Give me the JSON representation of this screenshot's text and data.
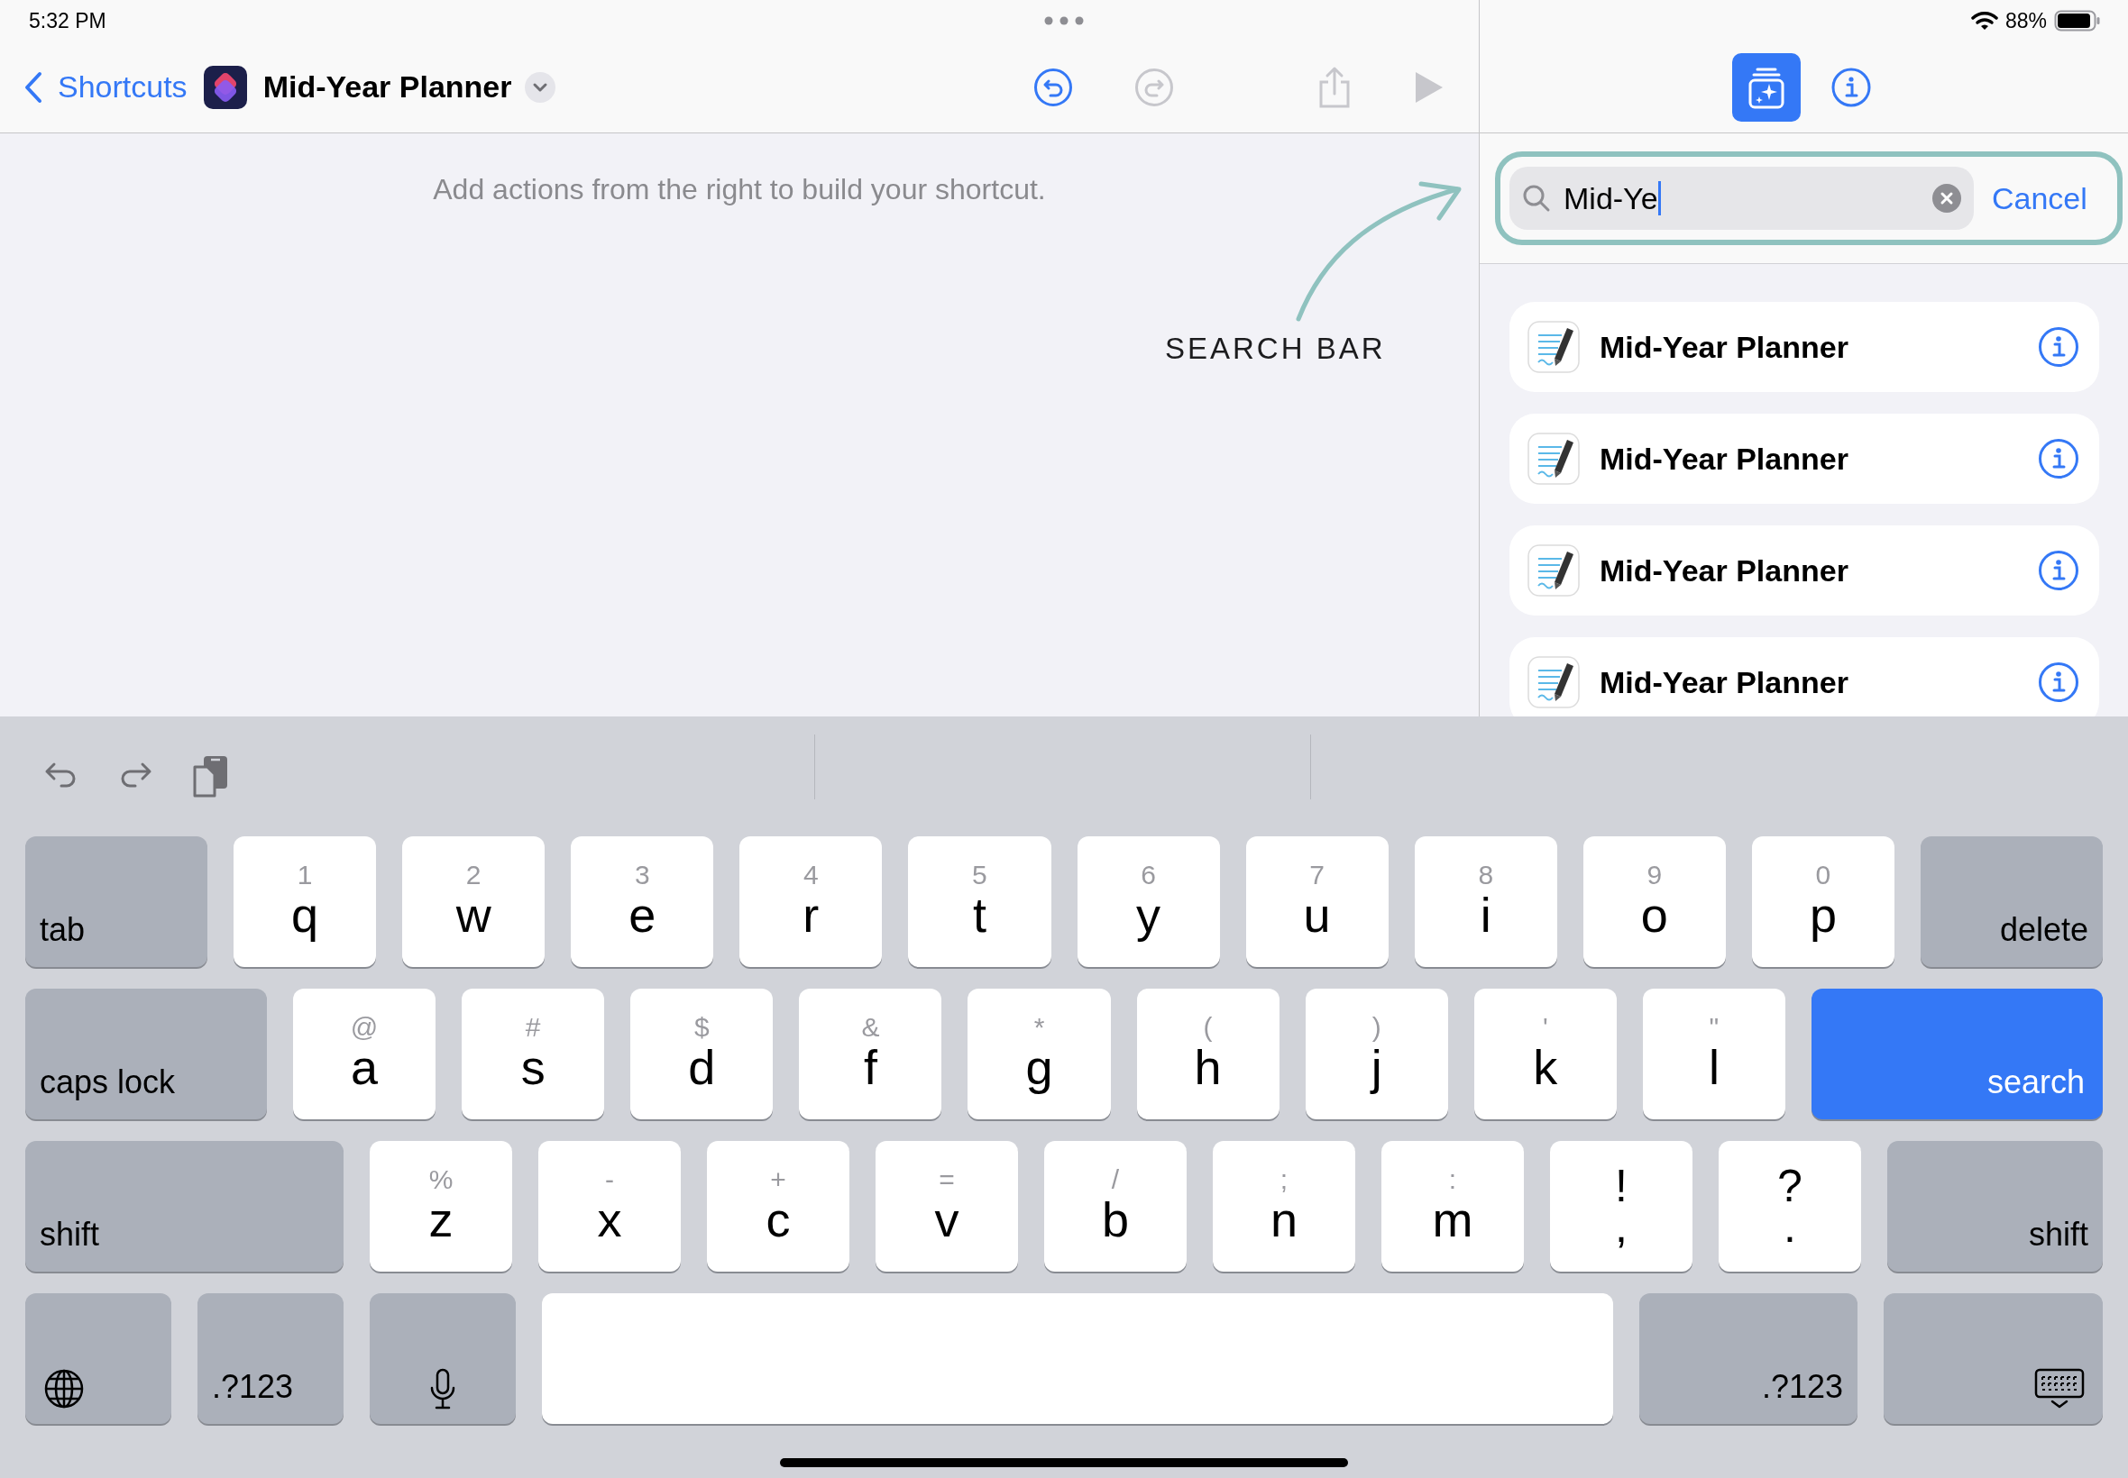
{
  "status_bar": {
    "time": "5:32 PM",
    "battery": "88%"
  },
  "nav": {
    "back": "Shortcuts",
    "title": "Mid-Year Planner"
  },
  "canvas": {
    "hint": "Add actions from the right to build your shortcut.",
    "annotation": "SEARCH BAR"
  },
  "panel_tabs": [
    {
      "kind": "actions",
      "selected": true
    },
    {
      "kind": "info",
      "selected": false
    }
  ],
  "search": {
    "value": "Mid-Ye",
    "cancel": "Cancel"
  },
  "results": [
    {
      "title": "Mid-Year Planner"
    },
    {
      "title": "Mid-Year Planner"
    },
    {
      "title": "Mid-Year Planner"
    },
    {
      "title": "Mid-Year Planner"
    }
  ],
  "keyboard": {
    "rows": [
      [
        {
          "kind": "function",
          "label": "tab"
        },
        {
          "kind": "letter",
          "label": "q",
          "hint": "1"
        },
        {
          "kind": "letter",
          "label": "w",
          "hint": "2"
        },
        {
          "kind": "letter",
          "label": "e",
          "hint": "3"
        },
        {
          "kind": "letter",
          "label": "r",
          "hint": "4"
        },
        {
          "kind": "letter",
          "label": "t",
          "hint": "5"
        },
        {
          "kind": "letter",
          "label": "y",
          "hint": "6"
        },
        {
          "kind": "letter",
          "label": "u",
          "hint": "7"
        },
        {
          "kind": "letter",
          "label": "i",
          "hint": "8"
        },
        {
          "kind": "letter",
          "label": "o",
          "hint": "9"
        },
        {
          "kind": "letter",
          "label": "p",
          "hint": "0"
        },
        {
          "kind": "function",
          "label": "delete"
        }
      ],
      [
        {
          "kind": "function",
          "label": "caps lock"
        },
        {
          "kind": "letter",
          "label": "a",
          "hint": "@"
        },
        {
          "kind": "letter",
          "label": "s",
          "hint": "#"
        },
        {
          "kind": "letter",
          "label": "d",
          "hint": "$"
        },
        {
          "kind": "letter",
          "label": "f",
          "hint": "&"
        },
        {
          "kind": "letter",
          "label": "g",
          "hint": "*"
        },
        {
          "kind": "letter",
          "label": "h",
          "hint": "("
        },
        {
          "kind": "letter",
          "label": "j",
          "hint": ")"
        },
        {
          "kind": "letter",
          "label": "k",
          "hint": "'"
        },
        {
          "kind": "letter",
          "label": "l",
          "hint": "\""
        },
        {
          "kind": "action",
          "label": "search"
        }
      ],
      [
        {
          "kind": "function",
          "label": "shift"
        },
        {
          "kind": "letter",
          "label": "z",
          "hint": "%"
        },
        {
          "kind": "letter",
          "label": "x",
          "hint": "-"
        },
        {
          "kind": "letter",
          "label": "c",
          "hint": "+"
        },
        {
          "kind": "letter",
          "label": "v",
          "hint": "="
        },
        {
          "kind": "letter",
          "label": "b",
          "hint": "/"
        },
        {
          "kind": "letter",
          "label": "n",
          "hint": ";"
        },
        {
          "kind": "letter",
          "label": "m",
          "hint": ":"
        },
        {
          "kind": "punct",
          "label": ",",
          "hint": "!"
        },
        {
          "kind": "punct",
          "label": ".",
          "hint": "?"
        },
        {
          "kind": "function",
          "label": "shift"
        }
      ],
      [
        {
          "kind": "globe"
        },
        {
          "kind": "function",
          "label": ".?123"
        },
        {
          "kind": "mic"
        },
        {
          "kind": "space"
        },
        {
          "kind": "function",
          "label": ".?123"
        },
        {
          "kind": "hide"
        }
      ]
    ]
  }
}
